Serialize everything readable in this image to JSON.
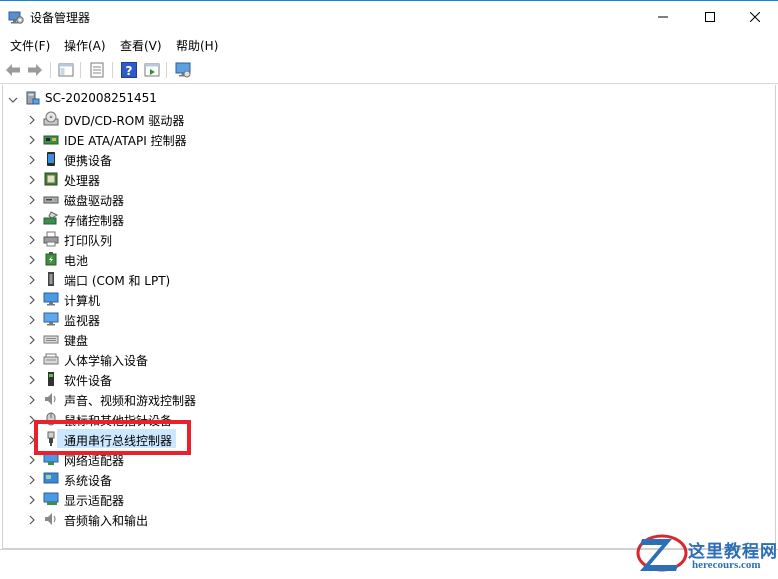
{
  "window": {
    "title": "设备管理器"
  },
  "menu": [
    "文件(F)",
    "操作(A)",
    "查看(V)",
    "帮助(H)"
  ],
  "toolbar": [
    "back-icon",
    "forward-icon",
    "show-hide-tree-icon",
    "properties-icon",
    "help-icon",
    "run-icon",
    "monitor-icon"
  ],
  "tree": {
    "root": "SC-202008251451",
    "items": [
      {
        "label": "DVD/CD-ROM 驱动器",
        "icon": "disc-drive-icon"
      },
      {
        "label": "IDE ATA/ATAPI 控制器",
        "icon": "ide-controller-icon"
      },
      {
        "label": "便携设备",
        "icon": "portable-device-icon"
      },
      {
        "label": "处理器",
        "icon": "processor-icon"
      },
      {
        "label": "磁盘驱动器",
        "icon": "disk-drive-icon"
      },
      {
        "label": "存储控制器",
        "icon": "storage-controller-icon"
      },
      {
        "label": "打印队列",
        "icon": "printer-icon"
      },
      {
        "label": "电池",
        "icon": "battery-icon"
      },
      {
        "label": "端口 (COM 和 LPT)",
        "icon": "port-icon"
      },
      {
        "label": "计算机",
        "icon": "computer-icon"
      },
      {
        "label": "监视器",
        "icon": "monitor-icon"
      },
      {
        "label": "键盘",
        "icon": "keyboard-icon"
      },
      {
        "label": "人体学输入设备",
        "icon": "hid-icon"
      },
      {
        "label": "软件设备",
        "icon": "software-device-icon"
      },
      {
        "label": "声音、视频和游戏控制器",
        "icon": "sound-icon"
      },
      {
        "label": "鼠标和其他指针设备",
        "icon": "mouse-icon"
      },
      {
        "label": "通用串行总线控制器",
        "icon": "usb-icon"
      },
      {
        "label": "网络适配器",
        "icon": "network-icon"
      },
      {
        "label": "系统设备",
        "icon": "system-device-icon"
      },
      {
        "label": "显示适配器",
        "icon": "display-adapter-icon"
      },
      {
        "label": "音频输入和输出",
        "icon": "audio-io-icon"
      }
    ],
    "selected_index": 16
  },
  "watermark": {
    "line1": "这里教程网",
    "line2": "herecours.com"
  },
  "colors": {
    "selection": "#cce8ff",
    "highlight_box": "#e8222a",
    "accent": "#1883d7"
  }
}
